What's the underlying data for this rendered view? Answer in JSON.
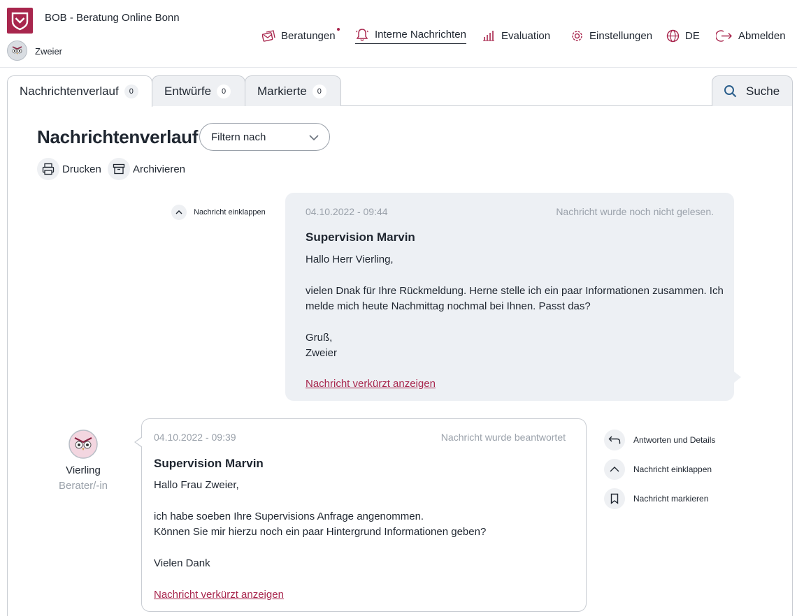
{
  "header": {
    "app_name": "BOB - Beratung Online Bonn",
    "user_name": "Zweier",
    "nav": [
      {
        "label": "Beratungen",
        "icon": "envelopes-icon",
        "has_notification": true
      },
      {
        "label": "Interne Nachrichten",
        "icon": "bell-icon",
        "active": true
      },
      {
        "label": "Evaluation",
        "icon": "bar-chart-icon"
      },
      {
        "label": "Einstellungen",
        "icon": "gear-icon"
      },
      {
        "label": "DE",
        "icon": "globe-icon"
      },
      {
        "label": "Abmelden",
        "icon": "logout-icon"
      }
    ]
  },
  "tabs": [
    {
      "label": "Nachrichtenverlauf",
      "count": "0",
      "active": true
    },
    {
      "label": "Entwürfe",
      "count": "0"
    },
    {
      "label": "Markierte",
      "count": "0"
    }
  ],
  "search_tab": {
    "label": "Suche"
  },
  "page": {
    "title": "Nachrichtenverlauf",
    "filter_placeholder": "Filtern nach",
    "actions": {
      "print": "Drucken",
      "archive": "Archivieren"
    }
  },
  "messages": [
    {
      "date": "04.10.2022 - 09:44",
      "status": "Nachricht wurde noch nicht gelesen.",
      "subject": "Supervision Marvin",
      "lines": [
        "Hallo Herr Vierling,",
        "vielen Dnak für Ihre Rückmeldung. Herne stelle ich ein paar Informationen zusammen. Ich",
        "melde mich heute Nachmittag nochmal bei Ihnen. Passt das?",
        "Gruß,",
        "Zweier"
      ],
      "link": "Nachricht verkürzt anzeigen",
      "collapse_label": "Nachricht einklappen"
    },
    {
      "date": "04.10.2022 - 09:39",
      "status": "Nachricht wurde beantwortet",
      "subject": "Supervision Marvin",
      "lines": [
        "Hallo Frau Zweier,",
        "ich habe soeben Ihre Supervisions Anfrage angenommen.",
        "Können Sie mir hierzu noch ein paar Hintergrund Informationen geben?",
        "Vielen Dank"
      ],
      "link": "Nachricht verkürzt anzeigen",
      "sender_name": "Vierling",
      "sender_role": "Berater/-in",
      "side_actions": {
        "reply": "Antworten und Details",
        "collapse": "Nachricht einklappen",
        "bookmark": "Nachricht markieren"
      }
    }
  ],
  "colors": {
    "accent": "#a8264d",
    "muted": "#9aa1aa",
    "bubble": "#edf0f4",
    "border": "#c9cdd3"
  }
}
